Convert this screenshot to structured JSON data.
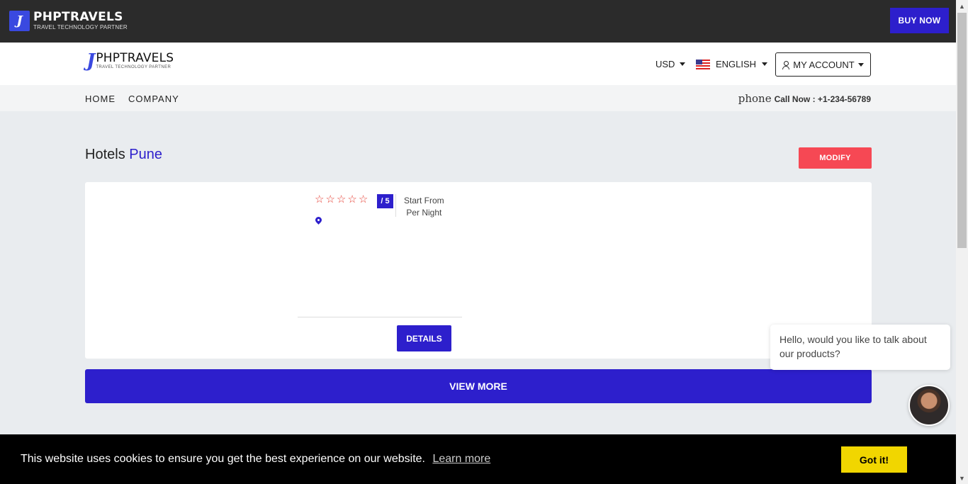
{
  "topbar": {
    "logo_name": "PHPTRAVELS",
    "logo_tagline": "TRAVEL TECHNOLOGY PARTNER",
    "buy_now": "BUY NOW"
  },
  "header": {
    "brand_name": "PHPTRAVELS",
    "brand_tagline": "TRAVEL TECHNOLOGY PARTNER",
    "currency": "USD",
    "language": "ENGLISH",
    "account": "MY ACCOUNT"
  },
  "nav": {
    "items": [
      "HOME",
      "COMPANY"
    ],
    "phone_icon_text": "phone",
    "phone": "Call Now : +1-234-56789"
  },
  "main": {
    "title_prefix": "Hotels",
    "title_city": "Pune",
    "modify": "MODIFY",
    "card": {
      "rating": "/ 5",
      "price_line1": "Start From",
      "price_line2": "Per Night",
      "details": "DETAILS"
    },
    "view_more": "VIEW MORE"
  },
  "chat": {
    "message": "Hello, would you like to talk about our products?"
  },
  "cookie": {
    "text": "This website uses cookies to ensure you get the best experience on our website.",
    "learn_more": "Learn more",
    "accept": "Got it!"
  },
  "colors": {
    "primary": "#2d1fcc",
    "modify": "#f64854",
    "cookie_button": "#f1d600",
    "topbar": "#2b2b2b"
  }
}
